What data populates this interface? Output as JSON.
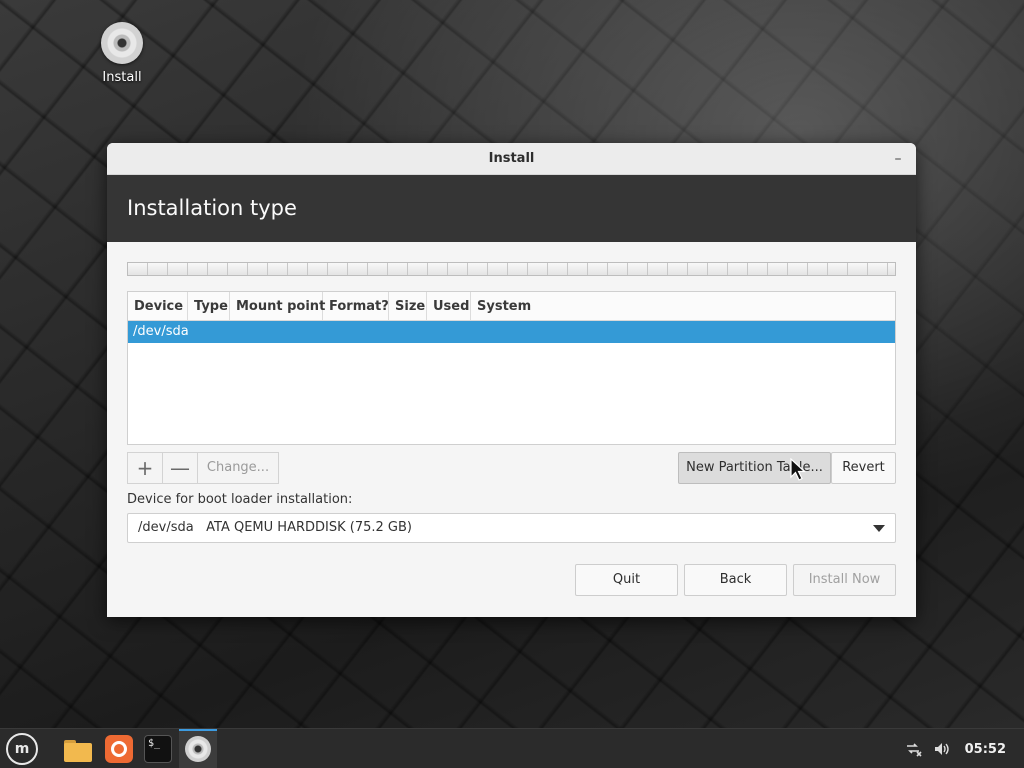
{
  "desktop": {
    "icon_label": "Install"
  },
  "window": {
    "title": "Install",
    "minimize_glyph": "–",
    "header": "Installation type"
  },
  "partition_table": {
    "columns": [
      "Device",
      "Type",
      "Mount point",
      "Format?",
      "Size",
      "Used",
      "System"
    ],
    "rows": [
      {
        "device": "/dev/sda",
        "selected": true
      }
    ]
  },
  "toolbar": {
    "add_label": "+",
    "remove_label": "—",
    "change_label": "Change...",
    "new_partition_table_label": "New Partition Table...",
    "revert_label": "Revert"
  },
  "boot_loader": {
    "label": "Device for boot loader installation:",
    "selected_device": "/dev/sda",
    "selected_description": "ATA QEMU HARDDISK (75.2 GB)"
  },
  "actions": {
    "quit_label": "Quit",
    "back_label": "Back",
    "install_now_label": "Install Now"
  },
  "taskbar": {
    "menu_icon": "mint-logo-icon",
    "launchers": [
      "folder-icon",
      "firefox-icon",
      "terminal-icon",
      "install-disc-icon"
    ],
    "clock": "05:52",
    "terminal_glyph": "$_"
  },
  "colors": {
    "selection": "#349ad6",
    "header_band": "#353535",
    "active_task_indicator": "#3d9be0"
  }
}
